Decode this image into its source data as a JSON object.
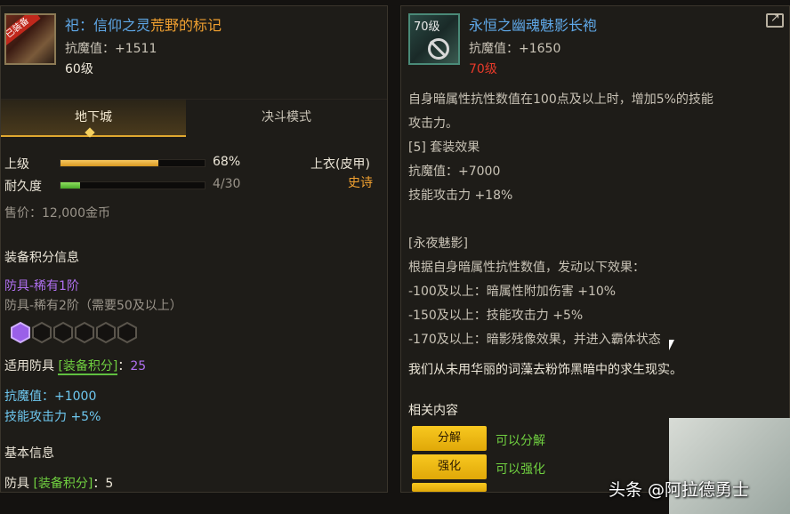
{
  "left": {
    "icon_badge": "已装备",
    "title_part1": "祀：信仰之灵",
    "title_part2": "荒野的标记",
    "stat_magic_res": "抗魔值：+1511",
    "level": "60级",
    "tabs": [
      "地下城",
      "决斗模式"
    ],
    "upgrade_label": "上级",
    "upgrade_percent": "68%",
    "upgrade_fill": 0.68,
    "durability_label": "耐久度",
    "durability_value": "4/30",
    "durability_fill": 0.133,
    "slot_type": "上衣(皮甲)",
    "rarity": "史诗",
    "price": "售价：12,000金币",
    "score_section_title": "装备积分信息",
    "armor_tier1": "防具-稀有1阶",
    "armor_tier2": "防具-稀有2阶（需要50及以上）",
    "hex_total": 6,
    "hex_active": 1,
    "applicable_prefix": "适用防具",
    "applicable_bracket": "[装备积分]",
    "applicable_colon": "：",
    "applicable_value": "25",
    "bonus_magic_res": "抗魔值：+1000",
    "bonus_skill_atk": "技能攻击力 +5%",
    "basic_info_title": "基本信息",
    "basic_prefix": "防具",
    "basic_bracket": "[装备积分]",
    "basic_colon": "：",
    "basic_value": "5"
  },
  "right": {
    "icon_level": "70级",
    "title": "永恒之幽魂魅影长袍",
    "stat_magic_res": "抗魔值：+1650",
    "level": "70级",
    "desc_lines": [
      "自身暗属性抗性数值在100点及以上时，增加5%的技能",
      "攻击力。",
      "[5] 套装效果",
      "抗魔值：+7000",
      "技能攻击力 +18%",
      "",
      "[永夜魅影]",
      "根据自身暗属性抗性数值，发动以下效果：",
      "-100及以上：暗属性附加伤害 +10%",
      "-150及以上：技能攻击力 +5%",
      "-170及以上：暗影残像效果，并进入霸体状态"
    ],
    "flavor_text": "我们从未用华丽的词藻去粉饰黑暗中的求生现实。",
    "related_title": "相关内容",
    "actions": [
      {
        "button": "分解",
        "note": "可以分解"
      },
      {
        "button": "强化",
        "note": "可以强化"
      }
    ]
  },
  "watermark": "头条 @阿拉德勇士",
  "colors": {
    "blue_title": "#5fa8e8",
    "orange": "#f0a030",
    "purple": "#b070f0",
    "cyan": "#6ec8f0",
    "green": "#70d040",
    "red_level": "#e83a2a",
    "yellow_button": "#f0b814"
  }
}
